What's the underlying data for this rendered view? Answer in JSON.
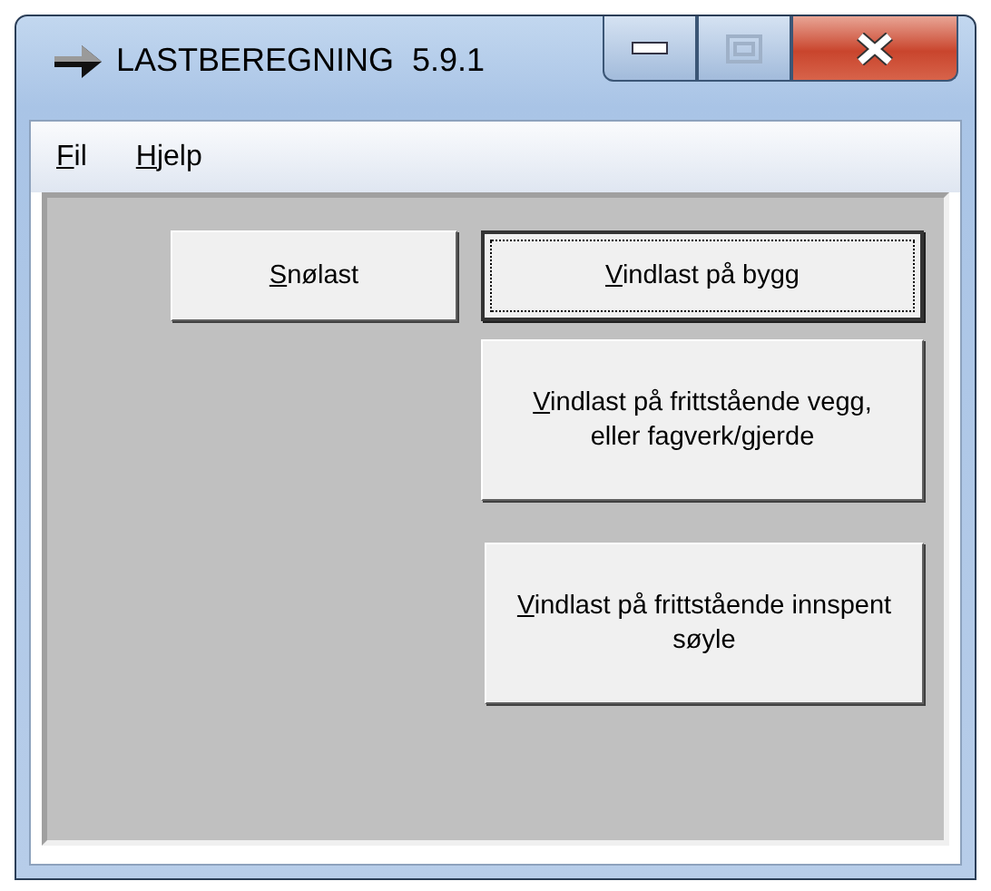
{
  "window": {
    "title": "LASTBEREGNING  5.9.1",
    "maximize_disabled": true
  },
  "menu": [
    {
      "label": "Fil"
    },
    {
      "label": "Hjelp"
    }
  ],
  "buttons": [
    {
      "label": "Snølast",
      "focused": false
    },
    {
      "label": "Vindlast på bygg",
      "focused": true
    },
    {
      "label": "Vindlast på frittstående vegg, eller fagverk/gjerde",
      "focused": false
    },
    {
      "label": "Vindlast på frittstående innspent søyle",
      "focused": false
    }
  ]
}
